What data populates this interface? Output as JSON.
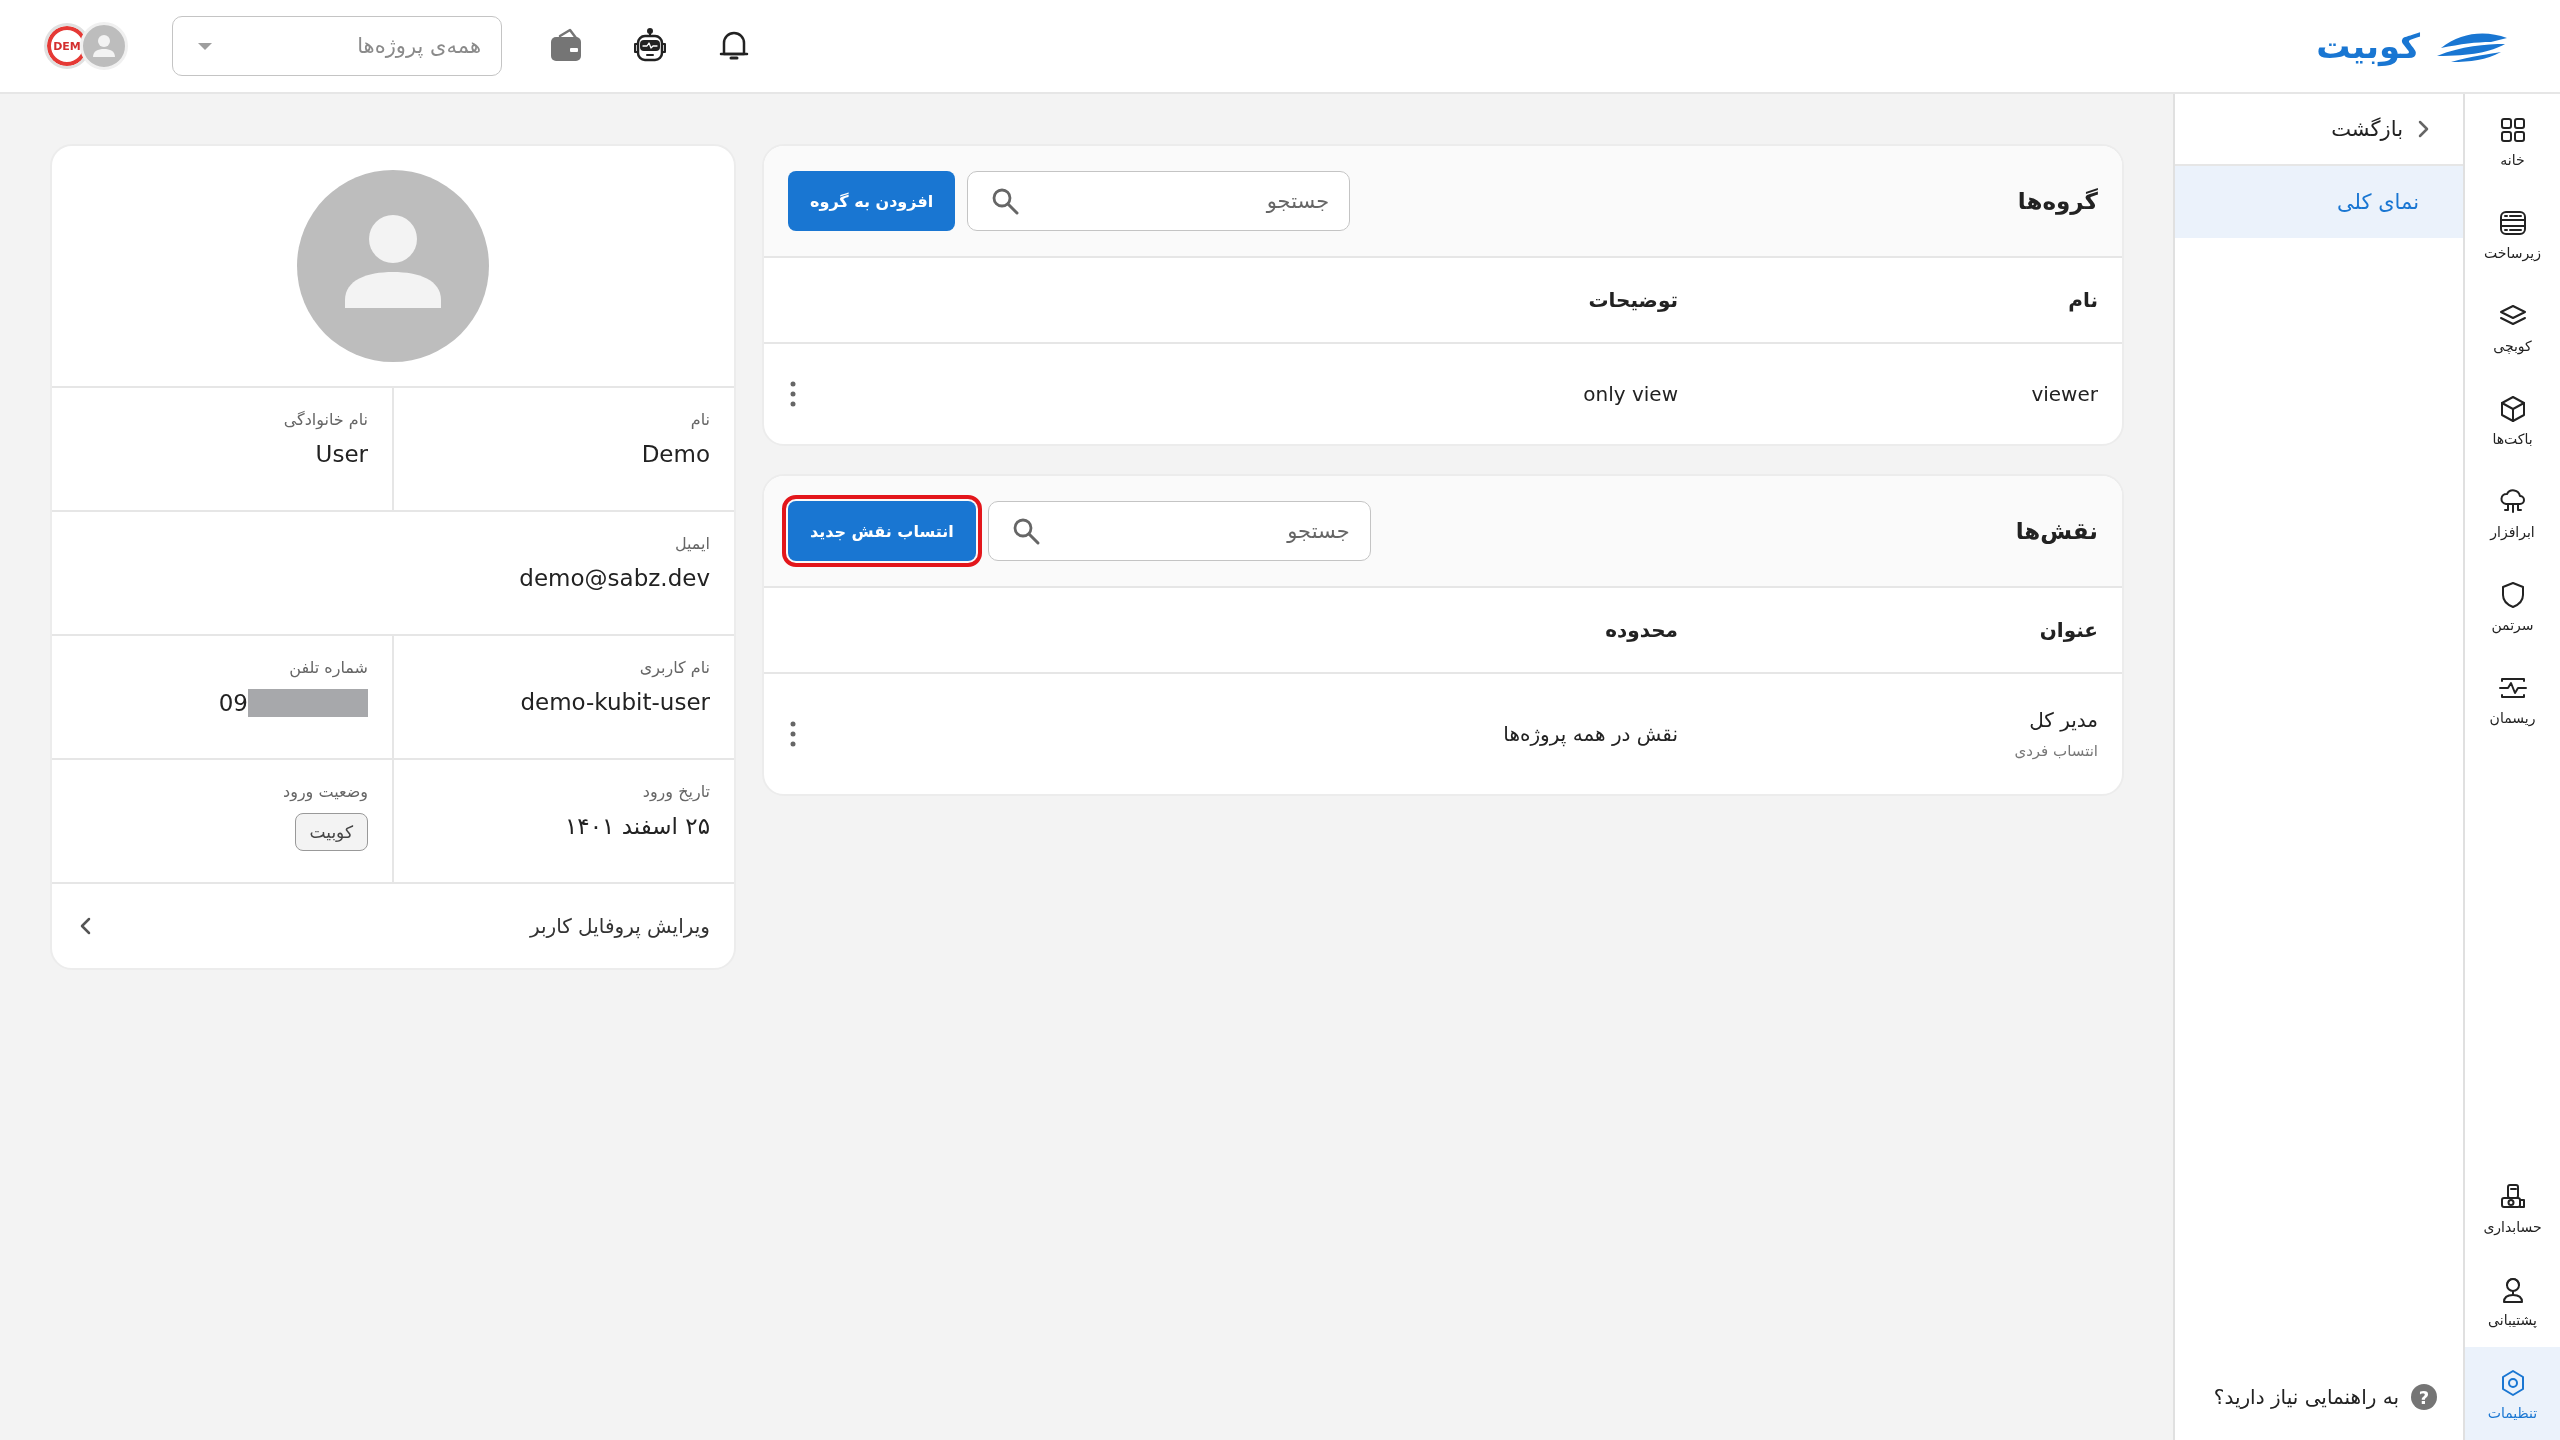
{
  "topbar": {
    "logo_text": "کوبیت",
    "project_select": {
      "placeholder": "همه‌ی پروژه‌ها"
    },
    "demo_badge": "DEM"
  },
  "rail": {
    "top_items": [
      {
        "label": "خانه",
        "selected": false
      },
      {
        "label": "زیرساخت",
        "selected": false
      },
      {
        "label": "کوبچی",
        "selected": false
      },
      {
        "label": "باکت‌ها",
        "selected": false
      },
      {
        "label": "ابرافزار",
        "selected": false
      },
      {
        "label": "سرتمن",
        "selected": false
      },
      {
        "label": "ریسمان",
        "selected": false
      }
    ],
    "bottom_items": [
      {
        "label": "حسابداری",
        "selected": false
      },
      {
        "label": "پشتیبانی",
        "selected": false
      },
      {
        "label": "تنظیمات",
        "selected": true
      }
    ]
  },
  "submenu": {
    "back": "بازگشت",
    "items": [
      {
        "label": "نمای کلی",
        "selected": true
      }
    ],
    "help": "به راهنمایی نیاز دارید؟",
    "help_mark": "?"
  },
  "groups": {
    "title": "گروه‌ها",
    "search": {
      "placeholder": "جستجو"
    },
    "action": {
      "label": "افزودن به گروه",
      "highlighted": false
    },
    "columns": [
      "نام",
      "توضیحات"
    ],
    "rows": [
      {
        "title": "viewer",
        "detail": "only view"
      }
    ]
  },
  "roles": {
    "title": "نقش‌ها",
    "search": {
      "placeholder": "جستجو"
    },
    "action": {
      "label": "انتساب نقش جدید",
      "highlighted": true
    },
    "columns": [
      "عنوان",
      "محدوده"
    ],
    "rows": [
      {
        "title": "مدیر کل",
        "subtitle": "انتساب فردی",
        "detail": "نقش در همه پروژه‌ها"
      }
    ]
  },
  "profile": {
    "rows": [
      {
        "fields": [
          {
            "label": "نام",
            "value": "Demo",
            "kind": "text"
          },
          {
            "label": "نام خانوادگی",
            "value": "User",
            "kind": "text"
          }
        ]
      },
      {
        "fields": [
          {
            "label": "ایمیل",
            "value": "demo@sabz.dev",
            "kind": "text"
          }
        ]
      },
      {
        "fields": [
          {
            "label": "نام کاربری",
            "value": "demo-kubit-user",
            "kind": "text"
          },
          {
            "label": "شماره تلفن",
            "value": "09",
            "kind": "redacted"
          }
        ]
      },
      {
        "fields": [
          {
            "label": "تاریخ ورود",
            "value": "۲۵ اسفند ۱۴۰۱",
            "kind": "text"
          },
          {
            "label": "وضعیت ورود",
            "value": "کوبیت",
            "kind": "tag"
          }
        ]
      }
    ],
    "edit_link": "ویرایش پروفایل کاربر"
  }
}
